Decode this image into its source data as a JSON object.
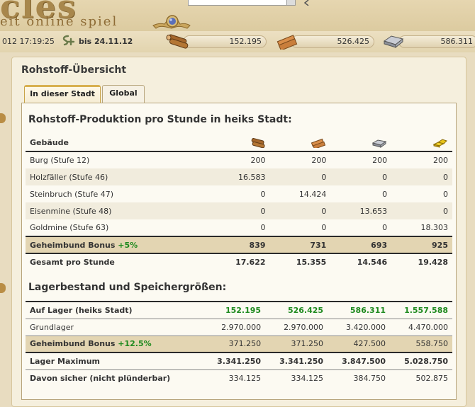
{
  "header": {
    "logo_text": "cles",
    "logo_subtitle": "eit online spiel",
    "emblem_icon": "compass-emblem-icon"
  },
  "status": {
    "datetime": "012 17:19:25",
    "premium_icon": "splus-premium-icon",
    "until": "bis 24.11.12"
  },
  "resources": [
    {
      "icon": "wood-icon",
      "value": "152.195"
    },
    {
      "icon": "stone-icon",
      "value": "526.425"
    },
    {
      "icon": "iron-icon",
      "value": "586.311"
    }
  ],
  "page": {
    "title": "Rohstoff-Übersicht"
  },
  "tabs": [
    {
      "label": "In dieser Stadt",
      "active": true
    },
    {
      "label": "Global",
      "active": false
    }
  ],
  "production": {
    "title": "Rohstoff-Produktion pro Stunde in heiks Stadt:",
    "header_label": "Gebäude",
    "resource_icons": [
      "wood-icon",
      "stone-icon",
      "iron-icon",
      "gold-icon"
    ],
    "rows": [
      {
        "label": "Burg (Stufe 12)",
        "values": [
          "200",
          "200",
          "200",
          "200"
        ]
      },
      {
        "label": "Holzfäller (Stufe 46)",
        "values": [
          "16.583",
          "0",
          "0",
          "0"
        ]
      },
      {
        "label": "Steinbruch (Stufe 47)",
        "values": [
          "0",
          "14.424",
          "0",
          "0"
        ]
      },
      {
        "label": "Eisenmine (Stufe 48)",
        "values": [
          "0",
          "0",
          "13.653",
          "0"
        ]
      },
      {
        "label": "Goldmine (Stufe 63)",
        "values": [
          "0",
          "0",
          "0",
          "18.303"
        ]
      }
    ],
    "bonus": {
      "label": "Geheimbund Bonus",
      "pct": "+5%",
      "values": [
        "839",
        "731",
        "693",
        "925"
      ]
    },
    "total": {
      "label": "Gesamt pro Stunde",
      "values": [
        "17.622",
        "15.355",
        "14.546",
        "19.428"
      ]
    }
  },
  "storage": {
    "title": "Lagerbestand und Speichergrößen:",
    "stock": {
      "label": "Auf Lager (heiks Stadt)",
      "values": [
        "152.195",
        "526.425",
        "586.311",
        "1.557.588"
      ]
    },
    "base": {
      "label": "Grundlager",
      "values": [
        "2.970.000",
        "2.970.000",
        "3.420.000",
        "4.470.000"
      ]
    },
    "bonus": {
      "label": "Geheimbund Bonus",
      "pct": "+12.5%",
      "values": [
        "371.250",
        "371.250",
        "427.500",
        "558.750"
      ]
    },
    "max": {
      "label": "Lager Maximum",
      "values": [
        "3.341.250",
        "3.341.250",
        "3.847.500",
        "5.028.750"
      ]
    },
    "safe": {
      "label": "Davon sicher (nicht plünderbar)",
      "values": [
        "334.125",
        "334.125",
        "384.750",
        "502.875"
      ]
    }
  },
  "colors": {
    "accent_gold": "#d8b050",
    "bonus_green": "#1f8a1f",
    "bonus_row": "#e3d5b2"
  }
}
